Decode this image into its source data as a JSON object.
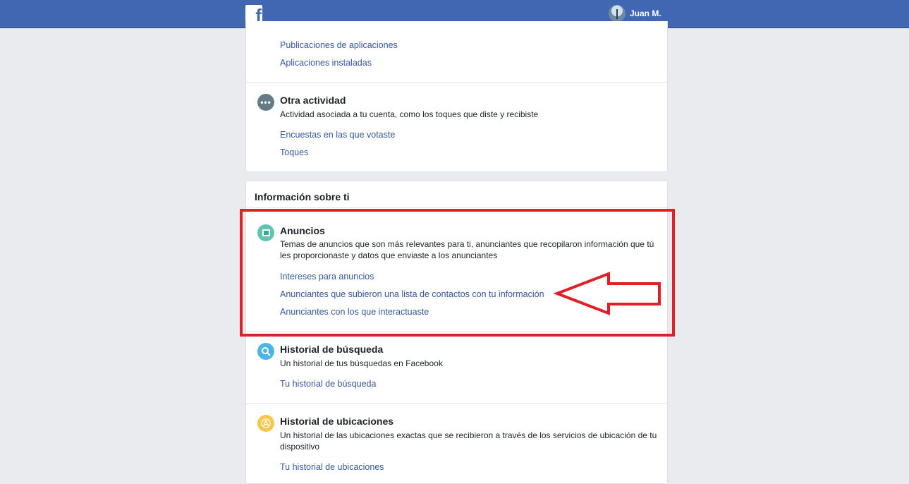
{
  "header": {
    "logo_icon": "facebook-f-icon",
    "user_name": "Juan M."
  },
  "card_top": {
    "links_top": [
      "Publicaciones de aplicaciones",
      "Aplicaciones instaladas"
    ],
    "other_activity": {
      "icon": "more-dots-icon",
      "title": "Otra actividad",
      "description": "Actividad asociada a tu cuenta, como los toques que diste y recibiste",
      "links": [
        "Encuestas en las que votaste",
        "Toques"
      ]
    }
  },
  "card_about": {
    "heading": "Información sobre ti",
    "ads": {
      "icon": "ads-screen-icon",
      "title": "Anuncios",
      "description": "Temas de anuncios que son más relevantes para ti, anunciantes que recopilaron información que tú les proporcionaste y datos que enviaste a los anunciantes",
      "links": [
        "Intereses para anuncios",
        "Anunciantes que subieron una lista de contactos con tu información",
        "Anunciantes con los que interactuaste"
      ]
    },
    "search_history": {
      "icon": "search-icon",
      "title": "Historial de búsqueda",
      "description": "Un historial de tus búsquedas en Facebook",
      "links": [
        "Tu historial de búsqueda"
      ]
    },
    "location_history": {
      "icon": "location-arrow-icon",
      "title": "Historial de ubicaciones",
      "description": "Un historial de las ubicaciones exactas que se recibieron a través de los servicios de ubicación de tu dispositivo",
      "links": [
        "Tu historial de ubicaciones"
      ]
    }
  },
  "annotation": {
    "highlight_color": "#e11f26",
    "arrow_icon": "left-arrow-outline-icon"
  },
  "colors": {
    "brand": "#4267b2",
    "link": "#365899",
    "background": "#e9ebee"
  }
}
